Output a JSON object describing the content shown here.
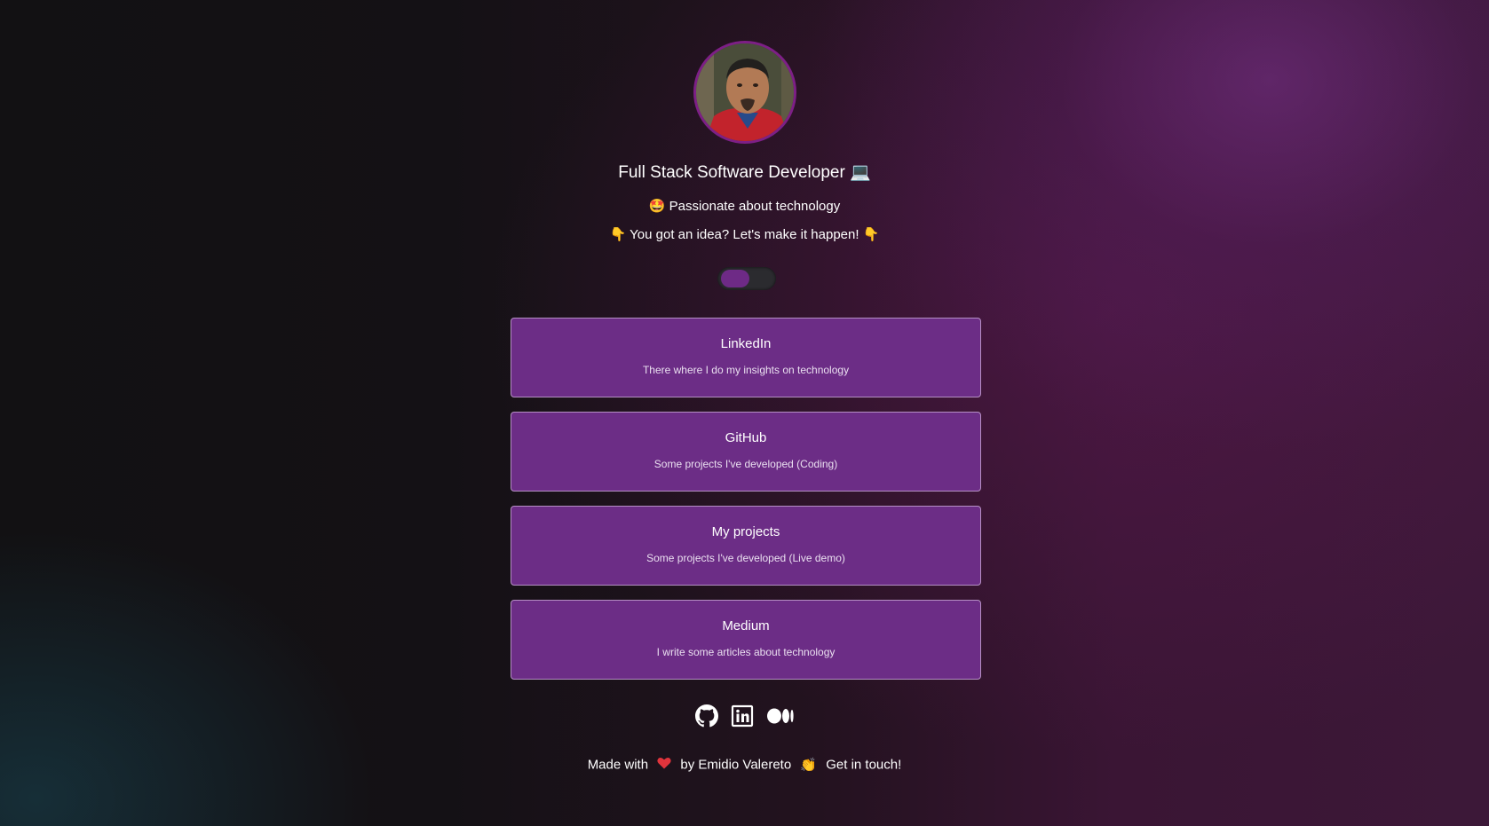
{
  "profile": {
    "title": "Full Stack Software Developer 💻",
    "line1": "🤩 Passionate about technology",
    "line2": "👇 You got an idea? Let's make it happen! 👇"
  },
  "links": [
    {
      "title": "LinkedIn",
      "description": "There where I do my insights on technology"
    },
    {
      "title": "GitHub",
      "description": "Some projects I've developed (Coding)"
    },
    {
      "title": "My projects",
      "description": "Some projects I've developed (Live demo)"
    },
    {
      "title": "Medium",
      "description": "I write some articles about technology"
    }
  ],
  "theme_toggle": {
    "state": "dark"
  },
  "socials": {
    "github": "github-icon",
    "linkedin": "linkedin-icon",
    "medium": "medium-icon"
  },
  "footer": {
    "made_with": "Made with",
    "by": "by Emidio Valereto",
    "clap": "👏",
    "cta": "Get in touch!"
  },
  "colors": {
    "accent": "#6c2d86",
    "card_border": "#b58fc4",
    "avatar_ring": "#7d1f86",
    "heart": "#e0343c"
  }
}
